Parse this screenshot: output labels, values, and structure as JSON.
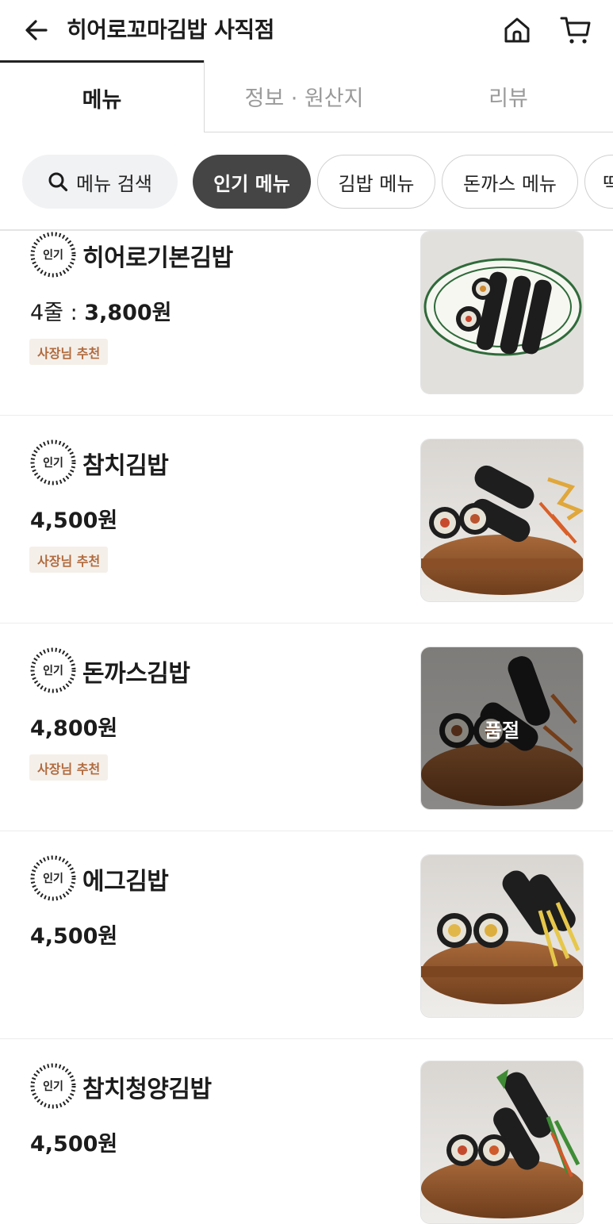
{
  "header": {
    "title": "히어로꼬마김밥 사직점",
    "back_icon": "arrow-left-icon",
    "home_icon": "home-icon",
    "cart_icon": "cart-icon"
  },
  "tabs": [
    {
      "label": "메뉴",
      "active": true
    },
    {
      "label": "정보 · 원산지",
      "active": false
    },
    {
      "label": "리뷰",
      "active": false
    }
  ],
  "chips": {
    "search_label": "메뉴 검색",
    "items": [
      "인기 메뉴",
      "김밥 메뉴",
      "돈까스 메뉴",
      "떡"
    ],
    "active_index": 0
  },
  "popular_badge": "인기",
  "recommend_tag": "사장님 추천",
  "soldout_label": "품절",
  "colors": {
    "active_chip_bg": "#454545",
    "tag_bg": "#f5efe9",
    "tag_text": "#b06b3f"
  },
  "items": [
    {
      "name": "히어로기본김밥",
      "price_prefix": "4줄 : ",
      "price": "3,800원",
      "tag": "사장님 추천",
      "sold_out": false
    },
    {
      "name": "참치김밥",
      "price_prefix": "",
      "price": "4,500원",
      "tag": "사장님 추천",
      "sold_out": false
    },
    {
      "name": "돈까스김밥",
      "price_prefix": "",
      "price": "4,800원",
      "tag": "사장님 추천",
      "sold_out": true
    },
    {
      "name": "에그김밥",
      "price_prefix": "",
      "price": "4,500원",
      "tag": "",
      "sold_out": false
    },
    {
      "name": "참치청양김밥",
      "price_prefix": "",
      "price": "4,500원",
      "tag": "",
      "sold_out": false
    }
  ]
}
